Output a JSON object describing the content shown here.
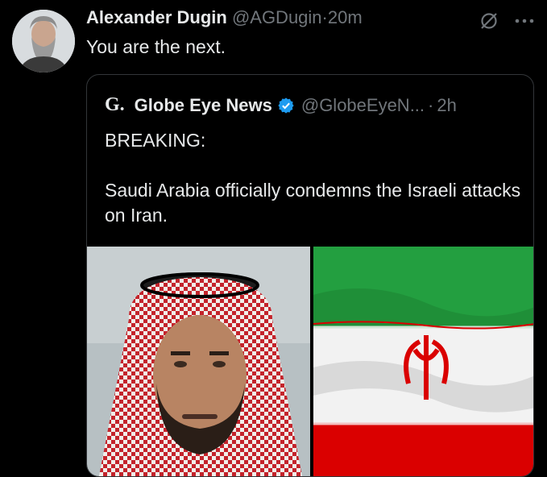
{
  "tweet": {
    "author_name": "Alexander Dugin",
    "author_handle": "@AGDugin",
    "separator": "·",
    "time": "20m",
    "text": "You are the next."
  },
  "quoted_tweet": {
    "logo_text": "G.",
    "author_name": "Globe Eye News",
    "verified": true,
    "author_handle": "@GlobeEyeN...",
    "separator": "·",
    "time": "2h",
    "text_line1": "BREAKING:",
    "text_line2": "Saudi Arabia officially condemns the Israeli attacks on Iran."
  },
  "icons": {
    "mute": "mute-icon",
    "more": "more-icon",
    "verified": "verified-badge-icon"
  },
  "colors": {
    "background": "#000000",
    "text": "#e7e9ea",
    "muted": "#71767b",
    "verified_blue": "#1d9bf0",
    "iran_green": "#239f40",
    "iran_red": "#da0000"
  }
}
